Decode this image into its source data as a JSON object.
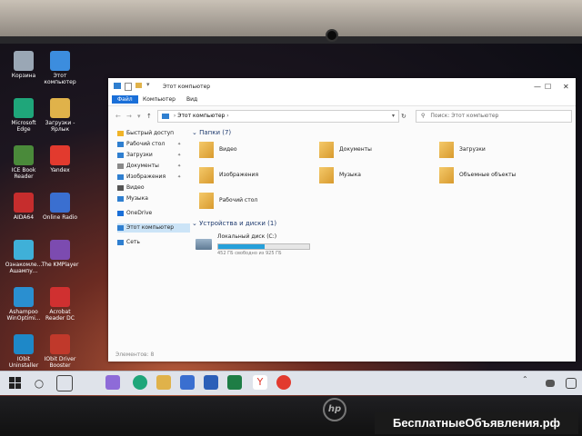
{
  "desktop": {
    "icons": [
      {
        "label": "Корзина",
        "color": "#9aa7b5"
      },
      {
        "label": "Этот компьютер",
        "color": "#3c8dde"
      },
      {
        "label": "Microsoft Edge",
        "color": "#1fa67a"
      },
      {
        "label": "Загрузки - Ярлык",
        "color": "#e0b24a"
      },
      {
        "label": "ICE Book Reader",
        "color": "#4a8a3a"
      },
      {
        "label": "Yandex",
        "color": "#e23a2e"
      },
      {
        "label": "AIDA64",
        "color": "#c62d2d"
      },
      {
        "label": "Online Radio",
        "color": "#3a6fd0"
      },
      {
        "label": "Ознакомле... Ашампу...",
        "color": "#3fb0d8"
      },
      {
        "label": "The KMPlayer",
        "color": "#7c4bb0"
      },
      {
        "label": "Ashampoo WinOptimi...",
        "color": "#2a8fd0"
      },
      {
        "label": "Acrobat Reader DC",
        "color": "#d03030"
      },
      {
        "label": "IObit Uninstaller",
        "color": "#1e88c8"
      },
      {
        "label": "IObit Driver Booster",
        "color": "#c0392b"
      }
    ]
  },
  "window": {
    "title": "Этот компьютер",
    "controls": {
      "minimize": "—",
      "maximize": "☐",
      "close": "✕"
    },
    "ribbon_tabs": [
      "Файл",
      "Компьютер",
      "Вид"
    ],
    "address": "Этот компьютер",
    "search_placeholder": "Поиск: Этот компьютер",
    "sidebar": [
      {
        "label": "Быстрый доступ",
        "icon": "star-icon",
        "color": "#f0b429"
      },
      {
        "label": "Рабочий стол",
        "icon": "desktop-icon",
        "color": "#2f7fd0",
        "pinned": true
      },
      {
        "label": "Загрузки",
        "icon": "download-icon",
        "color": "#2f7fd0",
        "pinned": true
      },
      {
        "label": "Документы",
        "icon": "document-icon",
        "color": "#8a8a8a",
        "pinned": true
      },
      {
        "label": "Изображения",
        "icon": "image-icon",
        "color": "#2f7fd0",
        "pinned": true
      },
      {
        "label": "Видео",
        "icon": "video-icon",
        "color": "#555555"
      },
      {
        "label": "Музыка",
        "icon": "music-icon",
        "color": "#2f7fd0"
      },
      {
        "label": "OneDrive",
        "icon": "cloud-icon",
        "color": "#1a6fd8"
      },
      {
        "label": "Этот компьютер",
        "icon": "computer-icon",
        "color": "#2f7fd0",
        "selected": true
      },
      {
        "label": "Сеть",
        "icon": "network-icon",
        "color": "#2f7fd0"
      }
    ],
    "folders_header": "Папки (7)",
    "folders": [
      {
        "label": "Видео",
        "icon": "video-folder-icon"
      },
      {
        "label": "Документы",
        "icon": "documents-folder-icon"
      },
      {
        "label": "Загрузки",
        "icon": "downloads-folder-icon"
      },
      {
        "label": "Изображения",
        "icon": "images-folder-icon"
      },
      {
        "label": "Музыка",
        "icon": "music-folder-icon"
      },
      {
        "label": "Объемные объекты",
        "icon": "3d-objects-folder-icon"
      },
      {
        "label": "Рабочий стол",
        "icon": "desktop-folder-icon"
      }
    ],
    "devices_header": "Устройства и диски (1)",
    "drive": {
      "name": "Локальный диск (C:)",
      "space": "452 ГБ свободно из 925 ГБ",
      "used_fraction": 0.51
    },
    "status": "Элементов: 8"
  },
  "watermark": "БесплатныеОбъявления.рф",
  "brand": "hp"
}
